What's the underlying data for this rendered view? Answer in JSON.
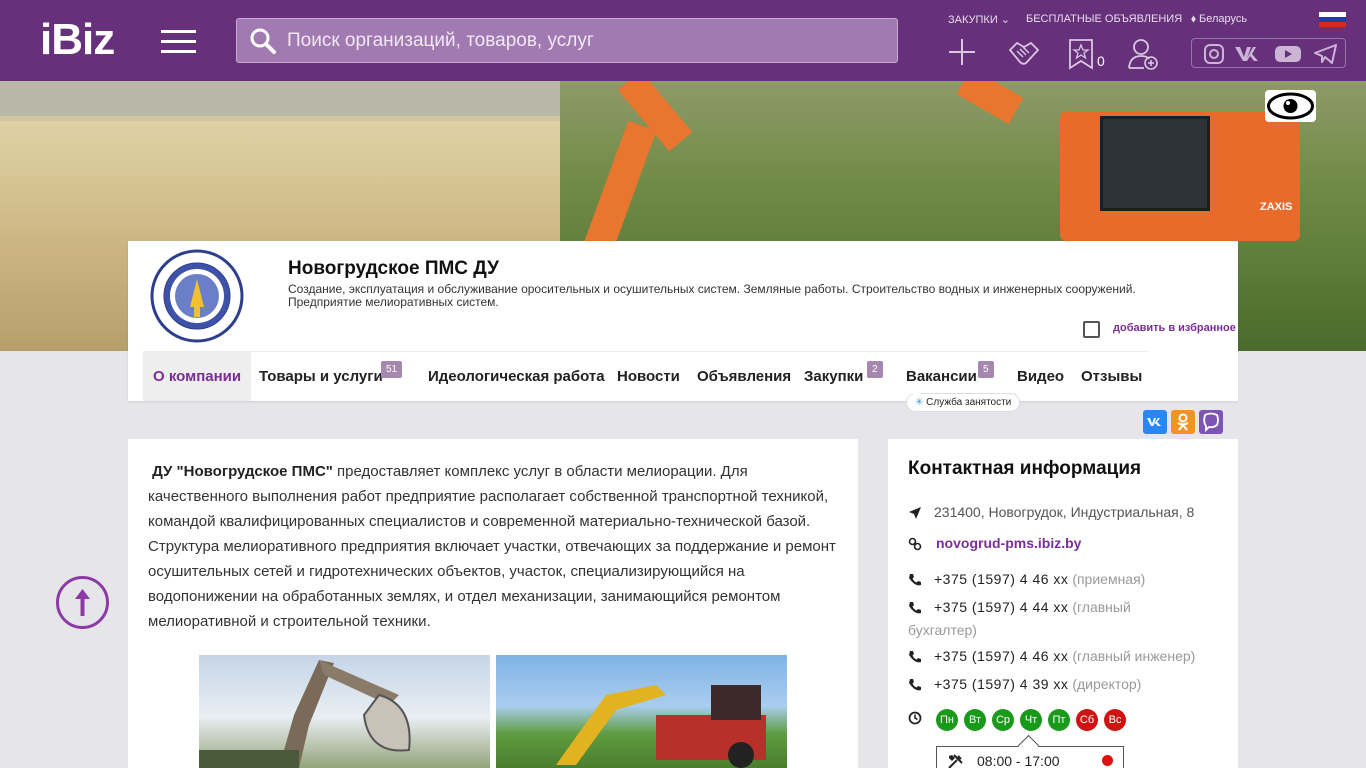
{
  "header": {
    "logo": "iBiz",
    "search_placeholder": "Поиск организаций, товаров, услуг",
    "links": {
      "purchases": "ЗАКУПКИ",
      "free_ads": "БЕСПЛАТНЫЕ ОБЪЯВЛЕНИЯ",
      "region": "Беларусь"
    },
    "favorites_count": "0",
    "brand_color": "#66307a"
  },
  "company": {
    "name": "Новогрудское ПМС ДУ",
    "description": "Создание, эксплуатация и обслуживание оросительных и осушительных систем. Земляные работы. Строительство водных и инженерных сооружений. Предприятие мелиоративных систем.",
    "add_favorite": "добавить в избранное"
  },
  "tabs": [
    {
      "label": "О компании",
      "badge": ""
    },
    {
      "label": "Товары и услуги",
      "badge": "51"
    },
    {
      "label": "Идеологическая работа",
      "badge": ""
    },
    {
      "label": "Новости",
      "badge": ""
    },
    {
      "label": "Объявления",
      "badge": ""
    },
    {
      "label": "Закупки",
      "badge": "2"
    },
    {
      "label": "Вакансии",
      "badge": "5"
    },
    {
      "label": "Видео",
      "badge": ""
    },
    {
      "label": "Отзывы",
      "badge": ""
    }
  ],
  "tab_tooltip": "Служба занятости",
  "article": {
    "company_bold": "ДУ \"Новогрудское ПМС\"",
    "text": " предоставляет комплекс услуг в области мелиорации. Для качественного выполнения работ предприятие располагает собственной транспортной техникой, командой квалифицированных специалистов и современной материально-технической базой. Структура мелиоративного предприятия включает участки, отвечающих за поддержание и ремонт осушительных сетей и гидротехнических объектов, участок, специализирующийся на водопонижении на обработанных землях, и отдел механизации, занимающийся ремонтом мелиоративной и строительной техники."
  },
  "contact": {
    "title": "Контактная информация",
    "address": "231400, Новогрудок, Индустриальная, 8",
    "website": "novogrud-pms.ibiz.by",
    "phones": [
      {
        "number": "+375 (1597) 4 46 xx",
        "note": "(приемная)"
      },
      {
        "number": "+375 (1597) 4 44 xx",
        "note": "(главный бухгалтер)"
      },
      {
        "number": "+375 (1597) 4 46 xx",
        "note": "(главный инженер)"
      },
      {
        "number": "+375 (1597) 4 39 xx",
        "note": "(директор)"
      }
    ],
    "days": [
      {
        "label": "Пн",
        "color": "#1a9a1a"
      },
      {
        "label": "Вт",
        "color": "#1a9a1a"
      },
      {
        "label": "Ср",
        "color": "#1a9a1a"
      },
      {
        "label": "Чт",
        "color": "#1a9a1a"
      },
      {
        "label": "Пт",
        "color": "#1a9a1a"
      },
      {
        "label": "Сб",
        "color": "#d01212"
      },
      {
        "label": "Вс",
        "color": "#d01212"
      }
    ],
    "hours": "08:00 - 17:00"
  }
}
